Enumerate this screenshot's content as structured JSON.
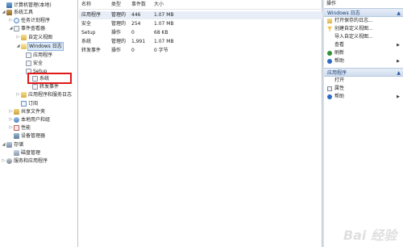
{
  "tree": {
    "root": "计算机管理(本地)",
    "items": [
      {
        "label": "系统工具"
      },
      {
        "label": "任务计划程序"
      },
      {
        "label": "事件查看器"
      },
      {
        "label": "自定义视图"
      },
      {
        "label": "Windows 日志"
      },
      {
        "label": "应用程序"
      },
      {
        "label": "安全"
      },
      {
        "label": "Setup"
      },
      {
        "label": "系统"
      },
      {
        "label": "转发事件"
      },
      {
        "label": "应用程序和服务日志"
      },
      {
        "label": "订阅"
      },
      {
        "label": "共享文件夹"
      },
      {
        "label": "本地用户和组"
      },
      {
        "label": "性能"
      },
      {
        "label": "设备管理器"
      },
      {
        "label": "存储"
      },
      {
        "label": "磁盘管理"
      },
      {
        "label": "服务和应用程序"
      }
    ]
  },
  "table": {
    "columns": [
      "名称",
      "类型",
      "事件数",
      "大小"
    ],
    "rows": [
      [
        "应用程序",
        "管理的",
        "446",
        "1.07 MB"
      ],
      [
        "安全",
        "管理的",
        "254",
        "1.07 MB"
      ],
      [
        "Setup",
        "操作",
        "0",
        "68 KB"
      ],
      [
        "系统",
        "管理的",
        "1,991",
        "1.07 MB"
      ],
      [
        "转发事件",
        "操作",
        "0",
        "0 字节"
      ]
    ]
  },
  "actions": {
    "title": "操作",
    "sections": [
      {
        "title": "Windows 日志",
        "items": [
          {
            "label": "打开保存的日志...",
            "icon": "open-folder-icon"
          },
          {
            "label": "创建自定义视图...",
            "icon": "filter-icon"
          },
          {
            "label": "导入自定义视图...",
            "icon": "blank"
          },
          {
            "label": "查看",
            "icon": "blank",
            "submenu": true
          },
          {
            "label": "刷新",
            "icon": "refresh-icon"
          },
          {
            "label": "帮助",
            "icon": "help-icon",
            "submenu": true
          }
        ]
      },
      {
        "title": "应用程序",
        "items": [
          {
            "label": "打开",
            "icon": "blank"
          },
          {
            "label": "属性",
            "icon": "properties-icon"
          },
          {
            "label": "帮助",
            "icon": "help-icon",
            "submenu": true
          }
        ]
      }
    ]
  },
  "watermark": "Bai 经验",
  "colors": {
    "accent": "#2d69c6",
    "highlight": "#e01818",
    "section_bg": "#cfdcee"
  }
}
